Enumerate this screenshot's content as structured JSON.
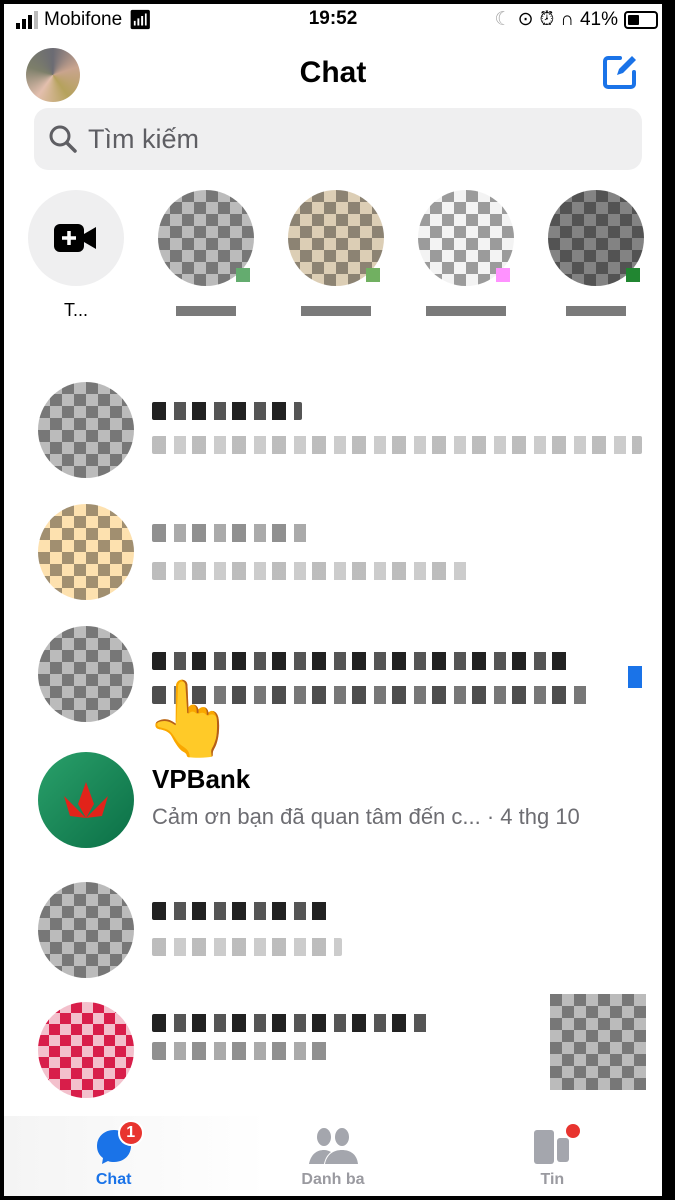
{
  "status_bar": {
    "carrier": "Mobifone",
    "time": "19:52",
    "battery_percent": "41%",
    "battery_level": 0.41
  },
  "header": {
    "title": "Chat",
    "icons": [
      "avatar",
      "compose-icon"
    ]
  },
  "search": {
    "placeholder": "Tìm kiếm"
  },
  "stories": {
    "create_label": "T...",
    "create_icon": "video-plus-icon"
  },
  "chats": [
    {
      "name": "VPBank",
      "message": "Cảm ơn bạn đã quan tâm đến c... · 4 thg 10"
    }
  ],
  "tabbar": {
    "tabs": [
      {
        "label": "Chat",
        "badge": "1",
        "active": true
      },
      {
        "label": "Danh ba"
      },
      {
        "label": "Tin",
        "dot": true
      }
    ]
  },
  "colors": {
    "accent": "#1a73e8",
    "online": "#2fc046",
    "badge": "#e8342f",
    "vpbank": "#108a55"
  }
}
